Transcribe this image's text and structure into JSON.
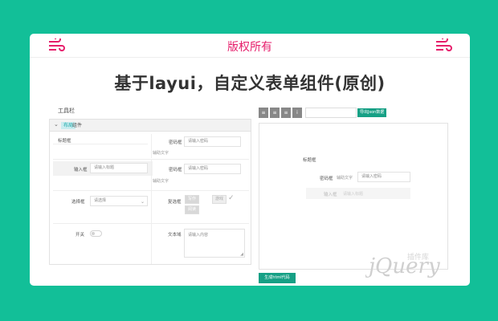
{
  "banner": {
    "copyright": "版权所有",
    "title": "基于layui，自定义表单组件(原创)"
  },
  "builder": {
    "toolbar_label": "工具栏",
    "group": {
      "tag": "布局",
      "text": "组件"
    },
    "fields": {
      "title_label": "标题框",
      "password1_label": "密码框",
      "password1_placeholder": "请输入密码",
      "hint1": "辅助文字",
      "input_label": "输入框",
      "input_placeholder": "请输入标题",
      "password2_label": "密码框",
      "password2_placeholder": "请输入密码",
      "hint2": "辅助文字",
      "select_label": "选择框",
      "select_placeholder": "请选择",
      "checkbox_label": "复选框",
      "checkbox_options": [
        "写作",
        "阅读"
      ],
      "checkbox_extra": "游戏",
      "switch_label": "开关",
      "textarea_label": "文本域",
      "textarea_placeholder": "请输入内容"
    }
  },
  "preview": {
    "toolbar_buttons": [
      "≡",
      "≡",
      "≡",
      "i"
    ],
    "import_button": "导出Json数据",
    "title_label": "标题框",
    "password_label": "密码框",
    "password_hint": "辅助文字",
    "password_placeholder": "请输入密码",
    "input_label": "输入框",
    "input_placeholder": "请输入标题",
    "generate_button": "生成html代码"
  },
  "watermark": {
    "text": "jQuery",
    "sub": "插件库"
  },
  "colors": {
    "background": "#12bf98",
    "accent": "#e61e6b",
    "button": "#16a085"
  }
}
